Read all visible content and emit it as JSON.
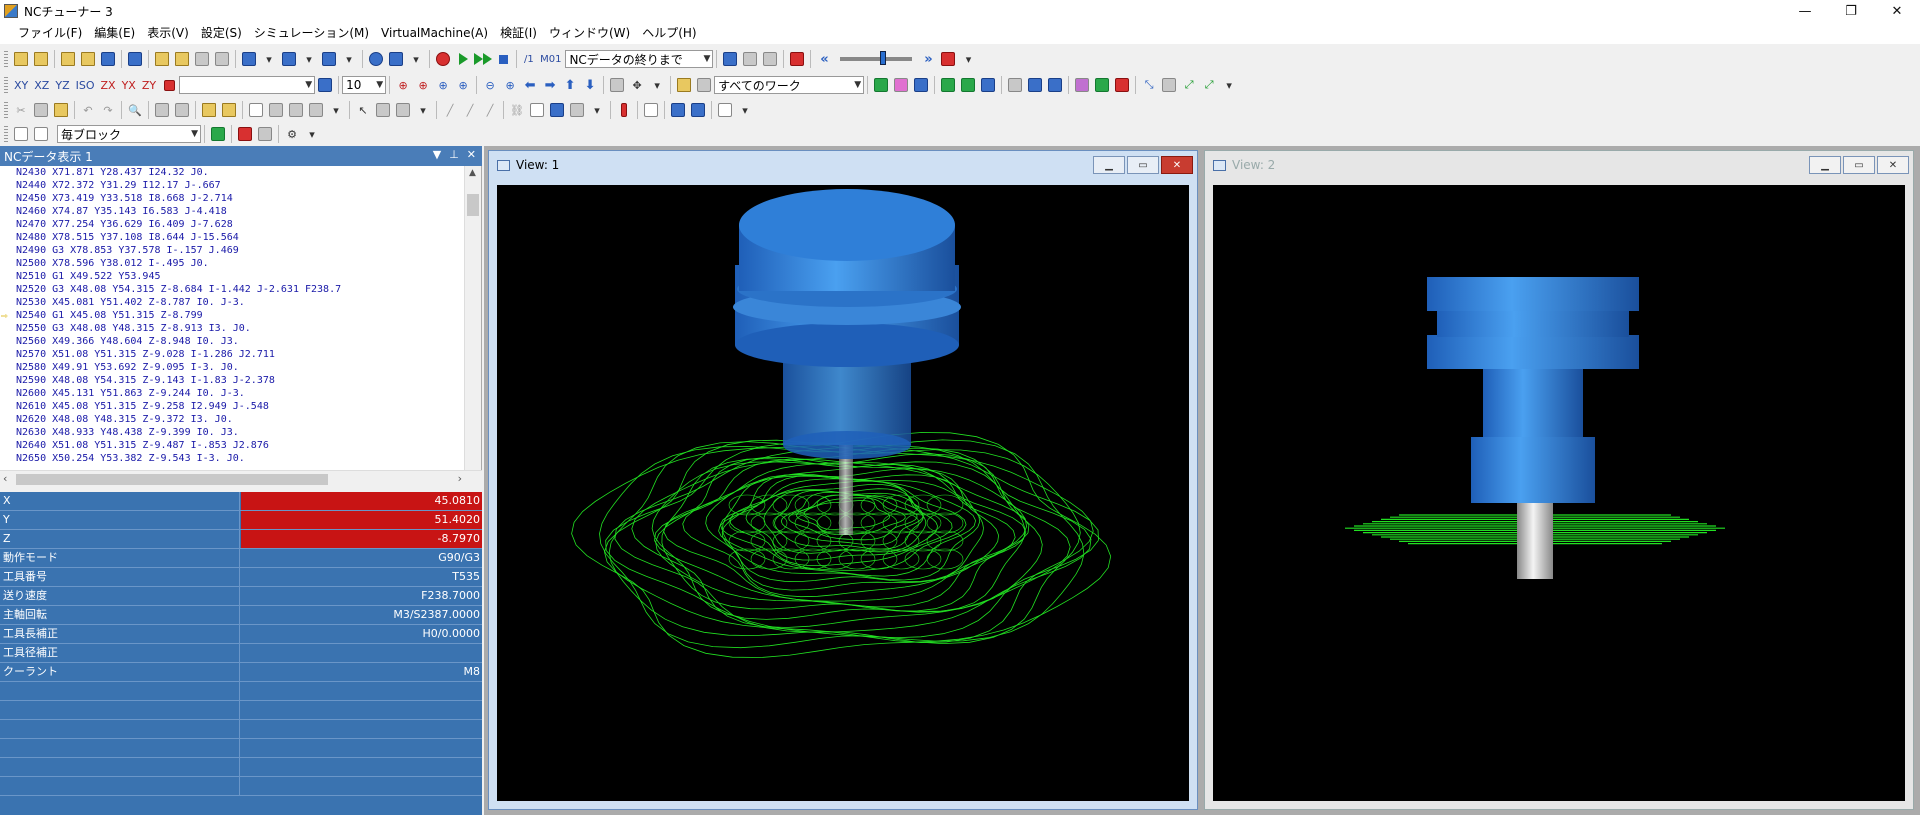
{
  "window": {
    "title": "NCチューナー 3",
    "minimize": "—",
    "maximize": "❐",
    "close": "✕"
  },
  "menu": [
    "ファイル(F)",
    "編集(E)",
    "表示(V)",
    "設定(S)",
    "シミュレーション(M)",
    "VirtualMachine(A)",
    "検証(I)",
    "ウィンドウ(W)",
    "ヘルプ(H)"
  ],
  "toolbar1": {
    "m01_label": "/1  M01",
    "nc_end_select": "NCデータの終りまで"
  },
  "toolbar2": {
    "axes": [
      "XY",
      "XZ",
      "YZ",
      "ISO",
      "ZX",
      "YX",
      "ZY"
    ],
    "size_select": "10",
    "work_select": "すべてのワーク"
  },
  "toolbar4": {
    "block_select": "毎ブロック"
  },
  "nc_panel": {
    "title": "NCデータ表示 1",
    "lines": [
      "N2430 X71.871 Y28.437 I24.32 J0.",
      "N2440 X72.372 Y31.29 I12.17 J-.667",
      "N2450 X73.419 Y33.518 I8.668 J-2.714",
      "N2460 X74.87 Y35.143 I6.583 J-4.418",
      "N2470 X77.254 Y36.629 I6.409 J-7.628",
      "N2480 X78.515 Y37.108 I8.644 J-15.564",
      "N2490 G3 X78.853 Y37.578 I-.157 J.469",
      "N2500 X78.596 Y38.012 I-.495 J0.",
      "N2510 G1 X49.522 Y53.945",
      "N2520 G3 X48.08 Y54.315 Z-8.684 I-1.442 J-2.631 F238.7",
      "N2530 X45.081 Y51.402 Z-8.787 I0. J-3.",
      "N2540 G1 X45.08 Y51.315 Z-8.799",
      "N2550 G3 X48.08 Y48.315 Z-8.913 I3. J0.",
      "N2560 X49.366 Y48.604 Z-8.948 I0. J3.",
      "N2570 X51.08 Y51.315 Z-9.028 I-1.286 J2.711",
      "N2580 X49.91 Y53.692 Z-9.095 I-3. J0.",
      "N2590 X48.08 Y54.315 Z-9.143 I-1.83 J-2.378",
      "N2600 X45.131 Y51.863 Z-9.244 I0. J-3.",
      "N2610 X45.08 Y51.315 Z-9.258 I2.949 J-.548",
      "N2620 X48.08 Y48.315 Z-9.372 I3. J0.",
      "N2630 X48.933 Y48.438 Z-9.399 I0. J3.",
      "N2640 X51.08 Y51.315 Z-9.487 I-.853 J2.876",
      "N2650 X50.254 Y53.382 Z-9.543 I-3. J0."
    ],
    "current_index": 11
  },
  "properties": [
    {
      "name": "X",
      "value": "45.0810",
      "highlight": true
    },
    {
      "name": "Y",
      "value": "51.4020",
      "highlight": true
    },
    {
      "name": "Z",
      "value": "-8.7970",
      "highlight": true
    },
    {
      "name": "動作モード",
      "value": "G90/G3"
    },
    {
      "name": "工具番号",
      "value": "T535"
    },
    {
      "name": "送り速度",
      "value": "F238.7000"
    },
    {
      "name": "主軸回転",
      "value": "M3/S2387.0000"
    },
    {
      "name": "工具長補正",
      "value": "H0/0.0000"
    },
    {
      "name": "工具径補正",
      "value": ""
    },
    {
      "name": "クーラント",
      "value": "M8"
    },
    {
      "name": "",
      "value": ""
    },
    {
      "name": "",
      "value": ""
    },
    {
      "name": "",
      "value": ""
    },
    {
      "name": "",
      "value": ""
    },
    {
      "name": "",
      "value": ""
    },
    {
      "name": "",
      "value": ""
    }
  ],
  "views": [
    {
      "title": "View: 1"
    },
    {
      "title": "View: 2"
    }
  ],
  "colors": {
    "tool_blue": "#2f7fd8",
    "toolpath_green": "#22e022",
    "selected_red": "#c81414"
  }
}
